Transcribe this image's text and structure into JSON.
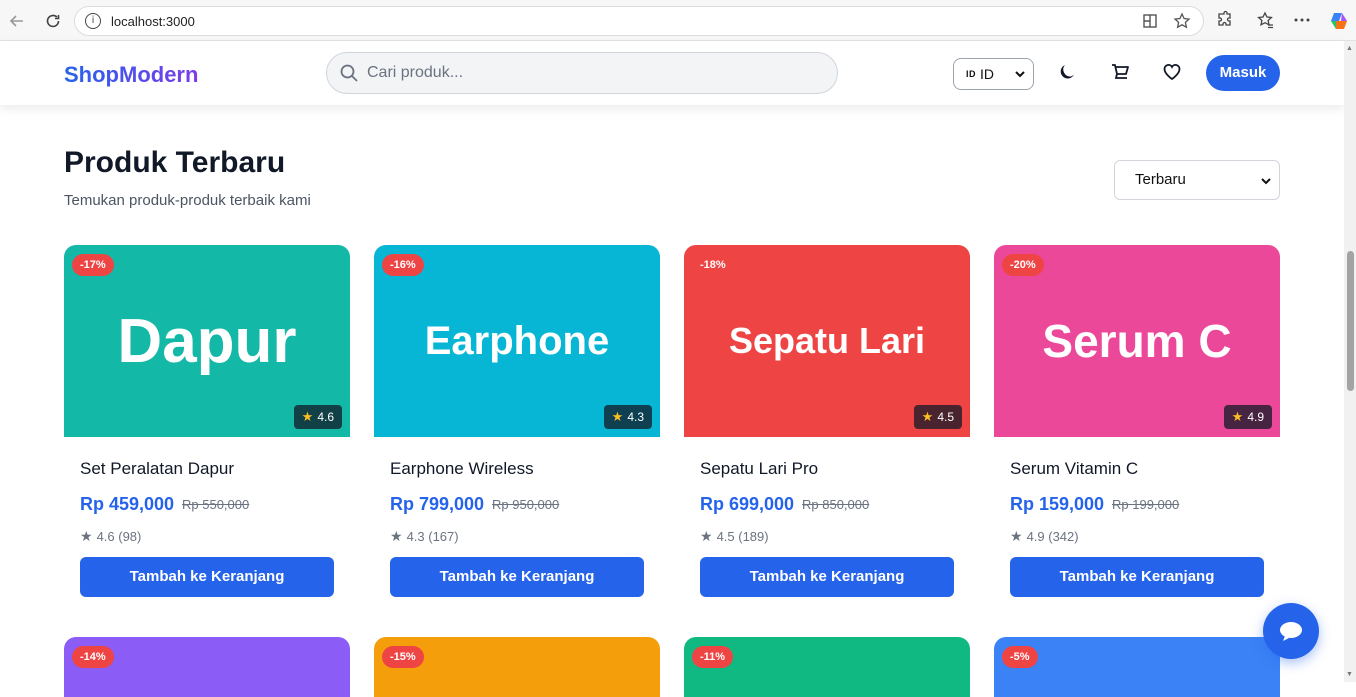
{
  "browser": {
    "url": "localhost:3000"
  },
  "header": {
    "logo": "ShopModern",
    "search_placeholder": "Cari produk...",
    "lang_flag": "ID",
    "lang_label": "ID",
    "login_label": "Masuk"
  },
  "main": {
    "title": "Produk Terbaru",
    "subtitle": "Temukan produk-produk terbaik kami",
    "sort_selected": "Terbaru"
  },
  "products": [
    {
      "image_text": "Dapur",
      "color": "#14b8a6",
      "discount": "-17%",
      "rating_badge": "4.6",
      "name": "Set Peralatan Dapur",
      "price": "Rp 459,000",
      "original_price": "Rp 550,000",
      "rating": "4.6 (98)",
      "button": "Tambah ke Keranjang"
    },
    {
      "image_text": "Earphone",
      "color": "#06b6d4",
      "discount": "-16%",
      "rating_badge": "4.3",
      "name": "Earphone Wireless",
      "price": "Rp 799,000",
      "original_price": "Rp 950,000",
      "rating": "4.3 (167)",
      "button": "Tambah ke Keranjang"
    },
    {
      "image_text": "Sepatu Lari",
      "color": "#ef4444",
      "discount": "-18%",
      "rating_badge": "4.5",
      "name": "Sepatu Lari Pro",
      "price": "Rp 699,000",
      "original_price": "Rp 850,000",
      "rating": "4.5 (189)",
      "button": "Tambah ke Keranjang"
    },
    {
      "image_text": "Serum C",
      "color": "#ec4899",
      "discount": "-20%",
      "rating_badge": "4.9",
      "name": "Serum Vitamin C",
      "price": "Rp 159,000",
      "original_price": "Rp 199,000",
      "rating": "4.9 (342)",
      "button": "Tambah ke Keranjang"
    }
  ],
  "products_row2": [
    {
      "color": "#8b5cf6",
      "discount": "-14%"
    },
    {
      "color": "#f59e0b",
      "discount": "-15%"
    },
    {
      "color": "#10b981",
      "discount": "-11%"
    },
    {
      "color": "#3b82f6",
      "discount": "-5%"
    }
  ],
  "colors": {
    "primary": "#2563eb",
    "discount_badge": "#ef4444"
  }
}
